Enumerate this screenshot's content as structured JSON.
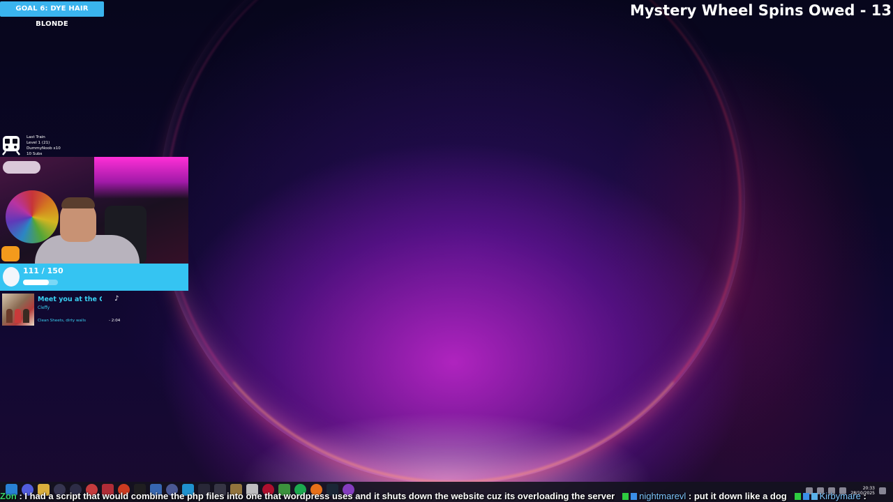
{
  "overlay": {
    "goal_label": "GOAL 6: DYE HAIR BLONDE",
    "wheel_text": "Mystery Wheel Spins Owed - 13"
  },
  "train": {
    "title": "Last Train",
    "level": "Level 1 (21)",
    "user": "DummyNoob x10",
    "subs": "10 Subs"
  },
  "subgoal": {
    "count_text": "111 / 150",
    "progress": 0.74
  },
  "now_playing": {
    "title": "Meet you at the Gravi",
    "artist": "Cleffy",
    "album": "Clean Sheets, dirty walls",
    "time": "- 2:04"
  },
  "chat": {
    "msg1_prefix": "Zon",
    "msg1_text": ": I had a script that would combine the php files into one that wordpress uses and it shuts down the website cuz its overloading the server",
    "msg2_user": "nightmarevl",
    "msg2_text": ": put it down like a dog",
    "msg3_user": "Kirbymare",
    "msg3_text": ":"
  },
  "taskbar": {
    "time": "20:33",
    "date": "28/10/2025"
  },
  "colors": {
    "accent": "#35c4f2",
    "goal_badge": "#3ab4ee",
    "song_text": "#39d0f2"
  }
}
